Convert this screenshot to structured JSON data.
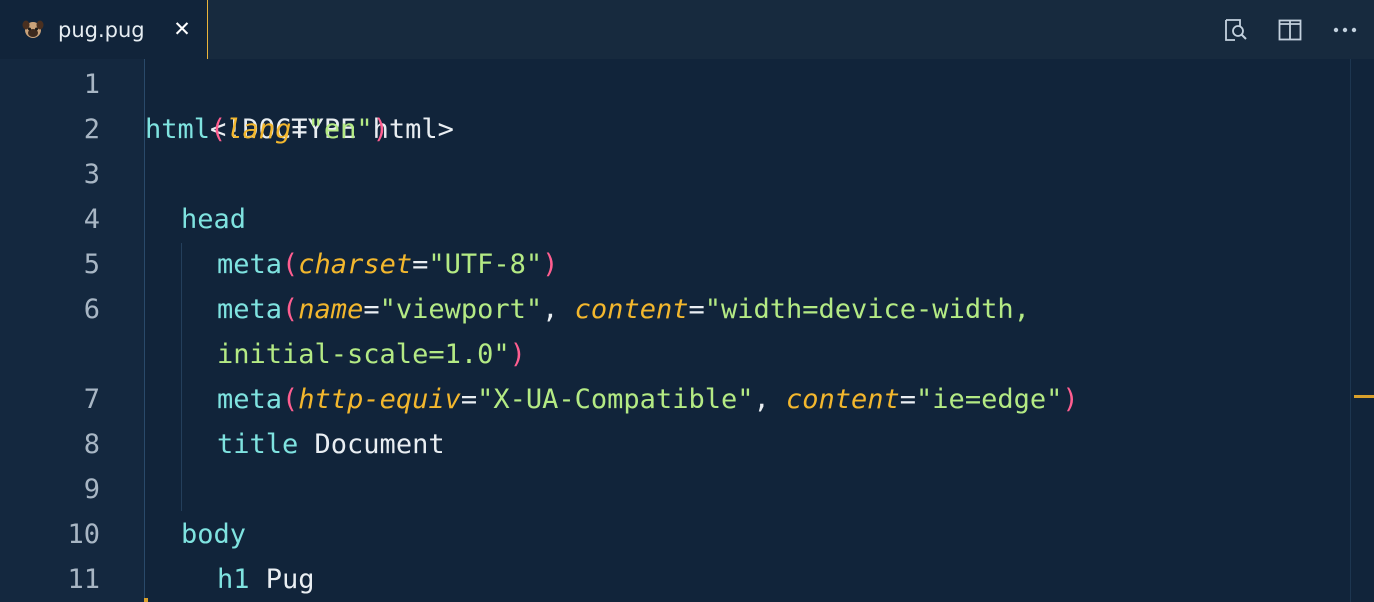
{
  "tab": {
    "label": "pug.pug",
    "close": "✕"
  },
  "actions": {
    "open_preview_icon": "open-preview-icon",
    "split_editor_icon": "split-editor-icon",
    "more_actions_icon": "more-actions-icon"
  },
  "colors": {
    "tag": "#7fe3e0",
    "attribute": "#f3b72d",
    "string": "#b4ea84",
    "paren": "#ff5e90",
    "text": "#e9eef2",
    "tab_border": "#eab43a"
  },
  "line_numbers": [
    "1",
    "2",
    "3",
    "4",
    "5",
    "6",
    "7",
    "8",
    "9",
    "10",
    "11"
  ],
  "code": {
    "l1": {
      "text": "<!DOCTYPE html>"
    },
    "l2": {
      "tag": "html",
      "open": "(",
      "attr": "lang",
      "eq": "=",
      "str": "\"en\"",
      "close": ")"
    },
    "l4": {
      "tag": "head"
    },
    "l5": {
      "tag": "meta",
      "open": "(",
      "attr": "charset",
      "eq": "=",
      "str": "\"UTF-8\"",
      "close": ")"
    },
    "l6": {
      "tag": "meta",
      "open": "(",
      "attr1": "name",
      "eq1": "=",
      "str1": "\"viewport\"",
      "sep": ", ",
      "attr2": "content",
      "eq2": "=",
      "str2a": "\"width=device-width,",
      "str2b": "initial-scale=1.0\"",
      "close": ")"
    },
    "l7": {
      "tag": "meta",
      "open": "(",
      "attr1": "http-equiv",
      "eq1": "=",
      "str1": "\"X-UA-Compatible\"",
      "sep": ", ",
      "attr2": "content",
      "eq2": "=",
      "str2": "\"ie=edge\"",
      "close": ")"
    },
    "l8": {
      "tag": "title",
      "text": " Document"
    },
    "l10": {
      "tag": "body"
    },
    "l11": {
      "tag": "h1",
      "text": " Pug"
    }
  }
}
